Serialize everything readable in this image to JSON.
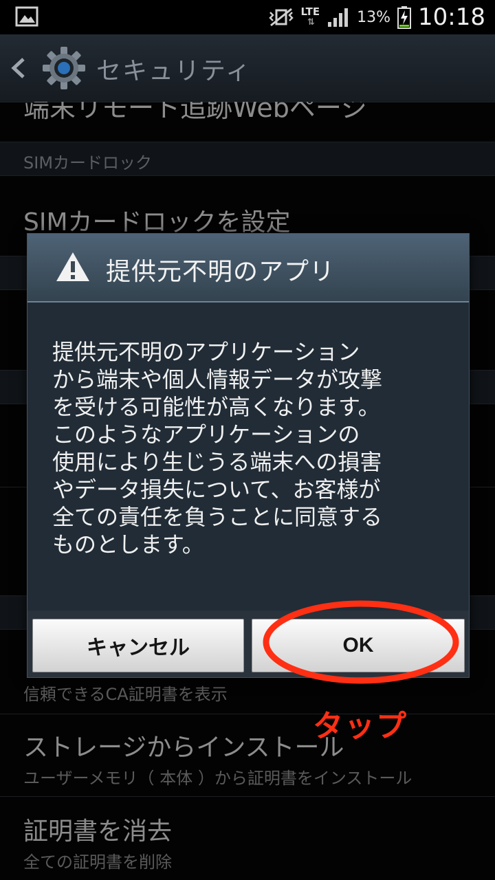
{
  "status_bar": {
    "network": "LTE",
    "battery_percent": "13%",
    "time": "10:18",
    "icons": [
      "gallery-icon",
      "mute-vibrate-icon",
      "signal-icon",
      "battery-charging-icon"
    ]
  },
  "action_bar": {
    "title": "セキュリティ",
    "icons": [
      "back-icon",
      "gear-icon"
    ]
  },
  "settings": {
    "partial_row": "端末リモート追跡Webページ",
    "section_sim": "SIMカードロック",
    "row_sim_lock": "SIMカードロックを設定",
    "row_trusted_sub": "信頼できるCA証明書を表示",
    "row_install_title": "ストレージからインストール",
    "row_install_sub": "ユーザーメモリ（ 本体 ）から証明書をインストール",
    "row_clear_title": "証明書を消去",
    "row_clear_sub": "全ての証明書を削除"
  },
  "dialog": {
    "title": "提供元不明のアプリ",
    "icon": "warning-icon",
    "message": "提供元不明のアプリケーション\nから端末や個人情報データが攻撃\nを受ける可能性が高くなります。\nこのようなアプリケーションの\n使用により生じうる端末への損害\nやデータ損失について、お客様が\n全ての責任を負うことに同意する\nものとします。",
    "cancel_label": "キャンセル",
    "ok_label": "OK"
  },
  "annotation": {
    "label": "タップ",
    "color": "#ff2f14"
  },
  "colors": {
    "background": "#050505",
    "dialog_background": "#212c36",
    "dialog_header": "#4e6376"
  }
}
